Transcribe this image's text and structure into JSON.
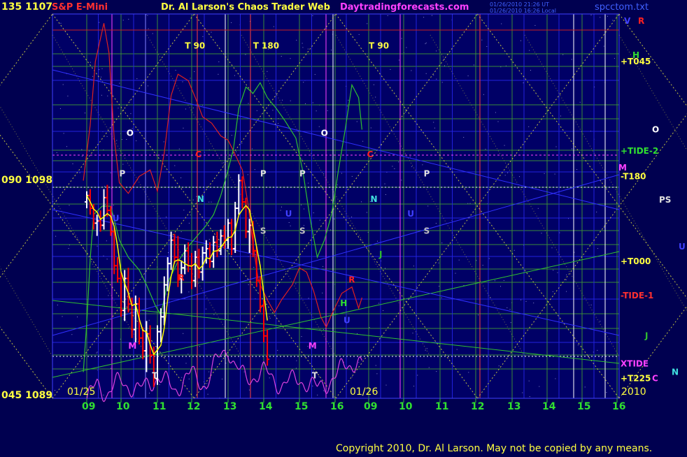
{
  "header": {
    "instrument": "S&P E-Mini",
    "title": "Dr. Al Larson's Chaos Trader Web",
    "website": "Daytradingforecasts.com",
    "timestamp_ut": "01/26/2010 21:26 UT",
    "timestamp_local": "01/26/2010 16:26 Local",
    "file_name": "spcctom.txt"
  },
  "copyright": "Copyright 2010, Dr. Al Larson. May not be copied by any means.",
  "colors": {
    "background": "#000050",
    "plot_background": "#000066",
    "grid_green": "#3a8a3a",
    "grid_blue": "#2222dd",
    "chaos_yellow": "#e0e040",
    "axis_text": "#ffff40",
    "red_curve": "#dd2020",
    "green_curve": "#30c030",
    "magenta_curve": "#dd40dd",
    "bar_up": "#ffffff",
    "bar_down": "#ff0000",
    "avg_line": "#ffff00"
  },
  "chart_data": {
    "type": "bar",
    "y_axis_left": {
      "ticks": [
        {
          "label": "135 1107",
          "value": 1107
        },
        {
          "label": "090 1098",
          "value": 1098
        },
        {
          "label": "045 1089",
          "value": 1089
        }
      ],
      "ylim": [
        1089,
        1107
      ]
    },
    "x_axis": {
      "tick_labels": [
        "09",
        "10",
        "11",
        "12",
        "13",
        "14",
        "15",
        "16",
        "09",
        "10",
        "11",
        "12",
        "13",
        "14",
        "15",
        "16"
      ],
      "date_labels": [
        "01/25",
        "01/26"
      ],
      "year_label": "2010",
      "hours_per_day": 7
    },
    "price_bars": [
      {
        "t": 0.0,
        "o": 1098.2,
        "h": 1098.7,
        "l": 1097.9,
        "c": 1098.5
      },
      {
        "t": 0.1,
        "o": 1098.5,
        "h": 1098.8,
        "l": 1097.6,
        "c": 1097.9
      },
      {
        "t": 0.2,
        "o": 1097.9,
        "h": 1098.1,
        "l": 1096.9,
        "c": 1097.2
      },
      {
        "t": 0.3,
        "o": 1097.2,
        "h": 1097.6,
        "l": 1096.6,
        "c": 1097.3
      },
      {
        "t": 0.4,
        "o": 1097.3,
        "h": 1097.8,
        "l": 1096.8,
        "c": 1097.1
      },
      {
        "t": 0.5,
        "o": 1097.1,
        "h": 1098.8,
        "l": 1096.9,
        "c": 1098.4
      },
      {
        "t": 0.6,
        "o": 1098.4,
        "h": 1099.0,
        "l": 1097.5,
        "c": 1097.8
      },
      {
        "t": 0.7,
        "o": 1097.8,
        "h": 1098.0,
        "l": 1096.6,
        "c": 1096.8
      },
      {
        "t": 0.8,
        "o": 1096.8,
        "h": 1097.0,
        "l": 1094.8,
        "c": 1095.2
      },
      {
        "t": 0.9,
        "o": 1095.2,
        "h": 1095.6,
        "l": 1094.4,
        "c": 1094.6
      },
      {
        "t": 1.0,
        "o": 1094.6,
        "h": 1094.9,
        "l": 1092.8,
        "c": 1093.1
      },
      {
        "t": 1.1,
        "o": 1093.1,
        "h": 1095.0,
        "l": 1092.6,
        "c": 1094.6
      },
      {
        "t": 1.2,
        "o": 1094.6,
        "h": 1095.1,
        "l": 1093.0,
        "c": 1093.4
      },
      {
        "t": 1.3,
        "o": 1093.4,
        "h": 1093.7,
        "l": 1091.8,
        "c": 1092.2
      },
      {
        "t": 1.4,
        "o": 1092.2,
        "h": 1093.8,
        "l": 1091.6,
        "c": 1093.4
      },
      {
        "t": 1.5,
        "o": 1093.4,
        "h": 1093.7,
        "l": 1091.5,
        "c": 1091.8
      },
      {
        "t": 1.6,
        "o": 1091.8,
        "h": 1092.3,
        "l": 1090.8,
        "c": 1091.2
      },
      {
        "t": 1.7,
        "o": 1091.2,
        "h": 1092.6,
        "l": 1090.2,
        "c": 1092.0
      },
      {
        "t": 1.8,
        "o": 1092.0,
        "h": 1092.4,
        "l": 1090.6,
        "c": 1091.0
      },
      {
        "t": 1.9,
        "o": 1091.0,
        "h": 1091.4,
        "l": 1089.5,
        "c": 1089.9
      },
      {
        "t": 2.0,
        "o": 1089.9,
        "h": 1092.4,
        "l": 1089.6,
        "c": 1092.1
      },
      {
        "t": 2.1,
        "o": 1092.1,
        "h": 1093.2,
        "l": 1091.6,
        "c": 1092.8
      },
      {
        "t": 2.2,
        "o": 1092.8,
        "h": 1094.7,
        "l": 1092.4,
        "c": 1094.3
      },
      {
        "t": 2.3,
        "o": 1094.3,
        "h": 1095.6,
        "l": 1094.0,
        "c": 1095.3
      },
      {
        "t": 2.4,
        "o": 1095.3,
        "h": 1096.8,
        "l": 1095.0,
        "c": 1096.4
      },
      {
        "t": 2.5,
        "o": 1096.4,
        "h": 1096.7,
        "l": 1095.3,
        "c": 1095.6
      },
      {
        "t": 2.6,
        "o": 1095.6,
        "h": 1096.6,
        "l": 1094.2,
        "c": 1094.6
      },
      {
        "t": 2.7,
        "o": 1094.6,
        "h": 1095.4,
        "l": 1093.9,
        "c": 1095.1
      },
      {
        "t": 2.8,
        "o": 1095.1,
        "h": 1096.2,
        "l": 1094.8,
        "c": 1095.9
      },
      {
        "t": 2.9,
        "o": 1095.9,
        "h": 1096.3,
        "l": 1094.9,
        "c": 1095.2
      },
      {
        "t": 3.0,
        "o": 1095.2,
        "h": 1095.8,
        "l": 1094.1,
        "c": 1094.5
      },
      {
        "t": 3.1,
        "o": 1094.5,
        "h": 1095.9,
        "l": 1094.2,
        "c": 1095.6
      },
      {
        "t": 3.2,
        "o": 1095.6,
        "h": 1096.0,
        "l": 1094.6,
        "c": 1094.9
      },
      {
        "t": 3.3,
        "o": 1094.9,
        "h": 1096.1,
        "l": 1094.5,
        "c": 1095.8
      },
      {
        "t": 3.4,
        "o": 1095.8,
        "h": 1096.4,
        "l": 1095.3,
        "c": 1096.0
      },
      {
        "t": 3.5,
        "o": 1096.0,
        "h": 1096.3,
        "l": 1095.1,
        "c": 1095.4
      },
      {
        "t": 3.6,
        "o": 1095.4,
        "h": 1096.6,
        "l": 1095.1,
        "c": 1096.3
      },
      {
        "t": 3.7,
        "o": 1096.3,
        "h": 1096.8,
        "l": 1095.6,
        "c": 1095.9
      },
      {
        "t": 3.8,
        "o": 1095.9,
        "h": 1096.9,
        "l": 1095.7,
        "c": 1096.6
      },
      {
        "t": 3.9,
        "o": 1096.6,
        "h": 1097.1,
        "l": 1096.0,
        "c": 1096.4
      },
      {
        "t": 4.0,
        "o": 1096.4,
        "h": 1097.4,
        "l": 1096.0,
        "c": 1097.2
      },
      {
        "t": 4.1,
        "o": 1097.2,
        "h": 1097.4,
        "l": 1095.7,
        "c": 1096.0
      },
      {
        "t": 4.2,
        "o": 1096.0,
        "h": 1098.2,
        "l": 1095.8,
        "c": 1097.9
      },
      {
        "t": 4.3,
        "o": 1097.9,
        "h": 1099.5,
        "l": 1097.6,
        "c": 1099.2
      },
      {
        "t": 4.4,
        "o": 1099.2,
        "h": 1099.4,
        "l": 1097.9,
        "c": 1098.2
      },
      {
        "t": 4.5,
        "o": 1098.2,
        "h": 1098.4,
        "l": 1096.5,
        "c": 1096.8
      },
      {
        "t": 4.6,
        "o": 1096.8,
        "h": 1097.4,
        "l": 1095.8,
        "c": 1097.1
      },
      {
        "t": 4.7,
        "o": 1097.1,
        "h": 1097.3,
        "l": 1095.6,
        "c": 1095.9
      },
      {
        "t": 4.8,
        "o": 1095.9,
        "h": 1096.1,
        "l": 1094.2,
        "c": 1094.5
      },
      {
        "t": 4.9,
        "o": 1094.5,
        "h": 1094.7,
        "l": 1093.0,
        "c": 1093.3
      },
      {
        "t": 5.0,
        "o": 1093.3,
        "h": 1093.6,
        "l": 1091.6,
        "c": 1091.9
      },
      {
        "t": 5.1,
        "o": 1091.9,
        "h": 1092.2,
        "l": 1090.5,
        "c": 1090.8
      }
    ],
    "background_curves": {
      "red": [
        [
          -0.1,
          1099.2
        ],
        [
          0.1,
          1101.8
        ],
        [
          0.25,
          1104.8
        ],
        [
          0.5,
          1106.6
        ],
        [
          0.65,
          1105.2
        ],
        [
          0.8,
          1101.2
        ],
        [
          0.95,
          1099.1
        ],
        [
          1.2,
          1098.6
        ],
        [
          1.5,
          1099.4
        ],
        [
          1.8,
          1099.7
        ],
        [
          2.0,
          1098.7
        ],
        [
          2.2,
          1100.5
        ],
        [
          2.4,
          1103.2
        ],
        [
          2.6,
          1104.2
        ],
        [
          2.9,
          1103.9
        ],
        [
          3.1,
          1103.1
        ],
        [
          3.3,
          1102.2
        ],
        [
          3.55,
          1101.9
        ],
        [
          3.8,
          1101.3
        ],
        [
          4.0,
          1101.1
        ],
        [
          4.15,
          1100.6
        ],
        [
          4.4,
          1099.7
        ],
        [
          4.55,
          1098.2
        ],
        [
          4.7,
          1096.2
        ],
        [
          4.85,
          1094.5
        ],
        [
          5.1,
          1093.6
        ],
        [
          5.3,
          1093.0
        ],
        [
          5.5,
          1093.6
        ],
        [
          5.8,
          1094.3
        ],
        [
          6.0,
          1095.1
        ],
        [
          6.2,
          1094.9
        ],
        [
          6.4,
          1094.0
        ],
        [
          6.6,
          1092.8
        ],
        [
          6.75,
          1092.3
        ],
        [
          6.9,
          1092.9
        ],
        [
          7.2,
          1093.9
        ],
        [
          7.5,
          1094.2
        ],
        [
          7.7,
          1093.2
        ],
        [
          7.8,
          1093.7
        ]
      ],
      "green": [
        [
          -0.1,
          1090.2
        ],
        [
          0.0,
          1092.5
        ],
        [
          0.1,
          1095.5
        ],
        [
          0.2,
          1097.6
        ],
        [
          0.45,
          1098.0
        ],
        [
          0.7,
          1098.0
        ],
        [
          0.95,
          1096.4
        ],
        [
          1.2,
          1095.6
        ],
        [
          1.5,
          1095.0
        ],
        [
          1.7,
          1094.3
        ],
        [
          1.95,
          1093.3
        ],
        [
          2.1,
          1092.9
        ],
        [
          2.3,
          1094.4
        ],
        [
          2.6,
          1095.4
        ],
        [
          2.9,
          1096.1
        ],
        [
          3.2,
          1096.7
        ],
        [
          3.4,
          1097.1
        ],
        [
          3.6,
          1097.6
        ],
        [
          3.8,
          1098.5
        ],
        [
          4.0,
          1099.7
        ],
        [
          4.15,
          1100.7
        ],
        [
          4.3,
          1102.6
        ],
        [
          4.5,
          1103.6
        ],
        [
          4.7,
          1103.3
        ],
        [
          4.9,
          1103.8
        ],
        [
          5.1,
          1103.1
        ],
        [
          5.35,
          1102.6
        ],
        [
          5.6,
          1102.0
        ],
        [
          5.9,
          1101.2
        ],
        [
          6.1,
          1099.6
        ],
        [
          6.3,
          1097.4
        ],
        [
          6.5,
          1095.6
        ],
        [
          6.7,
          1096.4
        ],
        [
          6.9,
          1097.6
        ],
        [
          7.1,
          1099.7
        ],
        [
          7.3,
          1101.6
        ],
        [
          7.5,
          1103.7
        ],
        [
          7.7,
          1103.1
        ],
        [
          7.8,
          1101.6
        ]
      ],
      "magenta": [
        [
          0.0,
          1088.9
        ],
        [
          0.3,
          1089.6
        ],
        [
          0.6,
          1089.2
        ],
        [
          1.0,
          1089.8
        ],
        [
          1.5,
          1089.3
        ],
        [
          2.0,
          1090.0
        ],
        [
          2.5,
          1089.4
        ],
        [
          3.0,
          1090.1
        ],
        [
          3.4,
          1089.6
        ],
        [
          3.6,
          1090.4
        ],
        [
          3.8,
          1091.0
        ],
        [
          4.0,
          1091.4
        ],
        [
          4.2,
          1090.4
        ],
        [
          4.5,
          1089.9
        ],
        [
          5.0,
          1090.2
        ],
        [
          5.5,
          1089.6
        ],
        [
          6.0,
          1089.9
        ],
        [
          6.5,
          1089.4
        ],
        [
          7.0,
          1090.0
        ],
        [
          7.3,
          1090.5
        ],
        [
          7.6,
          1090.7
        ],
        [
          7.8,
          1090.5
        ]
      ]
    },
    "price_labels_right": [
      {
        "label": "+T045",
        "value": 1104.8,
        "color": "#ffff40"
      },
      {
        "label": "+TIDE-2",
        "value": 1100.6,
        "color": "#30e030"
      },
      {
        "label": "-T180",
        "value": 1099.4,
        "color": "#ffff40"
      },
      {
        "label": "+T000",
        "value": 1095.4,
        "color": "#ffff40"
      },
      {
        "label": "-TIDE-1",
        "value": 1093.8,
        "color": "#ff3030"
      },
      {
        "label": "XTIDE",
        "value": 1090.6,
        "color": "#ff40ff"
      },
      {
        "label": "+T225",
        "value": 1089.9,
        "color": "#ffff40"
      }
    ],
    "planet_labels": [
      {
        "label": "O",
        "t": 1.15,
        "value": 1101.3,
        "color": "#ffffff"
      },
      {
        "label": "P",
        "t": 0.95,
        "value": 1099.4,
        "color": "#e0e0e0"
      },
      {
        "label": "C",
        "t": 3.1,
        "value": 1100.3,
        "color": "#ff2020"
      },
      {
        "label": "N",
        "t": 3.15,
        "value": 1098.2,
        "color": "#40e0e0"
      },
      {
        "label": "U",
        "t": 0.75,
        "value": 1097.3,
        "color": "#4040ff"
      },
      {
        "label": "M",
        "t": 1.2,
        "value": 1091.3,
        "color": "#ff40ff"
      },
      {
        "label": "R",
        "t": 2.6,
        "value": 1094.5,
        "color": "#ff2020"
      },
      {
        "label": "T",
        "t": 1.85,
        "value": 1089.9,
        "color": "#e0e0e0"
      },
      {
        "label": "P",
        "t": 4.9,
        "value": 1099.4,
        "color": "#e0e0e0"
      },
      {
        "label": "S",
        "t": 4.9,
        "value": 1096.7,
        "color": "#c0c0c0"
      },
      {
        "label": "U",
        "t": 5.6,
        "value": 1097.5,
        "color": "#4040ff"
      },
      {
        "label": "P",
        "t": 6.0,
        "value": 1099.4,
        "color": "#e0e0e0"
      },
      {
        "label": "S",
        "t": 6.0,
        "value": 1096.7,
        "color": "#c0c0c0"
      },
      {
        "label": "O",
        "t": 6.6,
        "value": 1101.3,
        "color": "#ffffff"
      },
      {
        "label": "M",
        "t": 6.25,
        "value": 1091.3,
        "color": "#ff40ff"
      },
      {
        "label": "T",
        "t": 6.35,
        "value": 1089.9,
        "color": "#e0e0e0"
      },
      {
        "label": "R",
        "t": 7.4,
        "value": 1094.4,
        "color": "#ff2020"
      },
      {
        "label": "H",
        "t": 7.15,
        "value": 1093.3,
        "color": "#30e030"
      },
      {
        "label": "U",
        "t": 7.25,
        "value": 1092.5,
        "color": "#4040ff"
      },
      {
        "label": "C",
        "t": 7.95,
        "value": 1100.3,
        "color": "#ff2020"
      },
      {
        "label": "N",
        "t": 8.05,
        "value": 1098.2,
        "color": "#40e0e0"
      },
      {
        "label": "J",
        "t": 8.3,
        "value": 1095.6,
        "color": "#30c030"
      },
      {
        "label": "U",
        "t": 9.1,
        "value": 1097.5,
        "color": "#4040ff"
      },
      {
        "label": "P",
        "t": 9.55,
        "value": 1099.4,
        "color": "#e0e0e0"
      },
      {
        "label": "S",
        "t": 9.55,
        "value": 1096.7,
        "color": "#c0c0c0"
      }
    ],
    "side_labels": [
      {
        "label": "V",
        "value": 1106.7,
        "color": "#4040ff"
      },
      {
        "label": "R",
        "value": 1106.7,
        "color": "#ff2020"
      },
      {
        "label": "H",
        "value": 1105.1,
        "color": "#30e030"
      },
      {
        "label": "O",
        "value": 1101.6,
        "color": "#ffffff"
      },
      {
        "label": "M",
        "value": 1099.8,
        "color": "#ff40ff"
      },
      {
        "label": "PS",
        "value": 1098.3,
        "color": "#e0e0e0"
      },
      {
        "label": "U",
        "value": 1096.1,
        "color": "#4040ff"
      },
      {
        "label": "J",
        "value": 1091.9,
        "color": "#30c030"
      },
      {
        "label": "N",
        "value": 1090.2,
        "color": "#40e0e0"
      },
      {
        "label": "C",
        "value": 1089.9,
        "color": "#ff40ff"
      }
    ],
    "cycle_labels": [
      {
        "label": "T  90",
        "t": 2.8,
        "value": 1105.4
      },
      {
        "label": "T  180",
        "t": 4.7,
        "value": 1105.4
      },
      {
        "label": "T  90",
        "t": 8.0,
        "value": 1105.4
      }
    ]
  }
}
